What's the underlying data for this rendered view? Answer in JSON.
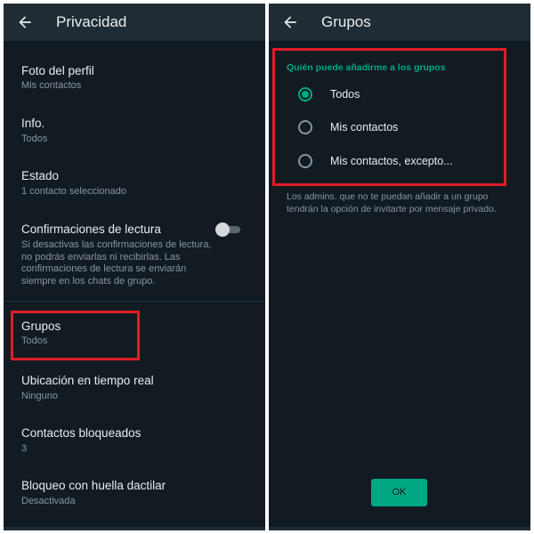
{
  "left": {
    "title": "Privacidad",
    "items": [
      {
        "title": "Foto del perfil",
        "subtitle": "Mis contactos"
      },
      {
        "title": "Info.",
        "subtitle": "Todos"
      },
      {
        "title": "Estado",
        "subtitle": "1 contacto seleccionado"
      },
      {
        "title": "Confirmaciones de lectura",
        "subtitle": "Si desactivas las confirmaciones de lectura, no podrás enviarlas ni recibirlas. Las confirmaciones de lectura se enviarán siempre en los chats de grupo.",
        "toggle_on": false
      },
      {
        "title": "Grupos",
        "subtitle": "Todos"
      },
      {
        "title": "Ubicación en tiempo real",
        "subtitle": "Ninguno"
      },
      {
        "title": "Contactos bloqueados",
        "subtitle": "3"
      },
      {
        "title": "Bloqueo con huella dactilar",
        "subtitle": "Desactivada"
      }
    ]
  },
  "right": {
    "title": "Grupos",
    "section_header": "Quién puede añadirme a los grupos",
    "options": [
      {
        "label": "Todos",
        "selected": true
      },
      {
        "label": "Mis contactos",
        "selected": false
      },
      {
        "label": "Mis contactos, excepto...",
        "selected": false
      }
    ],
    "note": "Los admins. que no te puedan añadir a un grupo tendrán la opción de invitarte por mensaje privado.",
    "ok_label": "OK"
  },
  "colors": {
    "accent": "#00a884",
    "highlight": "#e01e27",
    "background": "#121b22",
    "appbar": "#1f2c34",
    "text_primary": "#e9edef",
    "text_secondary": "#8696a0"
  },
  "icons": {
    "back": "arrow-left-icon"
  }
}
